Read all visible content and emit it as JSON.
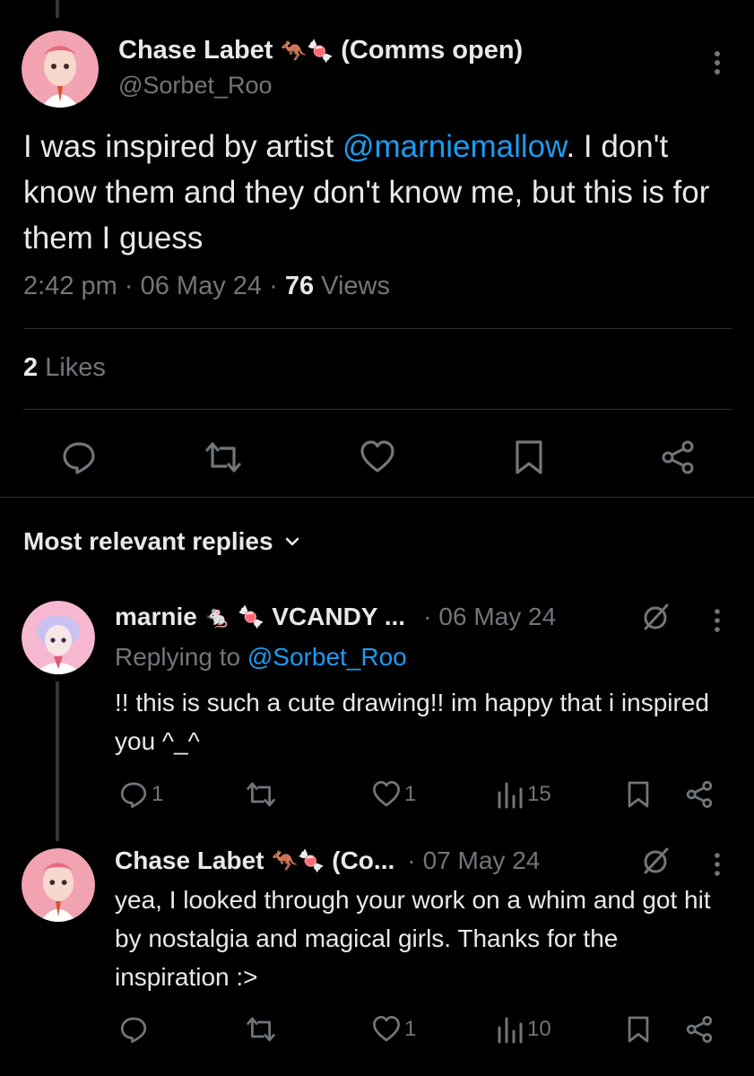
{
  "colors": {
    "bg": "#000000",
    "text": "#e7e9ea",
    "muted": "#71767b",
    "link": "#1d9bf0",
    "divider": "#2f3336"
  },
  "main_tweet": {
    "display_name": "Chase Labet",
    "name_emojis": "🦘🍬",
    "name_suffix": "(Comms open)",
    "handle": "@Sorbet_Roo",
    "text_before": "I was inspired by artist ",
    "mention": "@marniemallow",
    "text_after": ". I don't know them and they don't know me, but this is for them I guess",
    "time": "2:42 pm",
    "date": "06 May 24",
    "views_count": "76",
    "views_label": "Views",
    "likes_count": "2",
    "likes_label": "Likes",
    "sep": "·"
  },
  "replies_header": {
    "label": "Most relevant replies"
  },
  "replies": [
    {
      "display_name": "marnie",
      "name_emojis": "🐁 🍬",
      "name_suffix": "VCANDY ...",
      "date": "06 May 24",
      "replying_label": "Replying to ",
      "replying_to": "@Sorbet_Roo",
      "text": "!! this is such a cute drawing!! im happy that i inspired you ^_^",
      "replies_count": "1",
      "likes_count": "1",
      "views_count": "15"
    },
    {
      "display_name": "Chase Labet",
      "name_emojis": "🦘🍬",
      "name_suffix": "(Co...",
      "date": "07 May 24",
      "text": "yea, I looked through your work on a whim and got hit by nostalgia and magical girls. Thanks for the inspiration  :>",
      "likes_count": "1",
      "views_count": "10"
    }
  ],
  "icons": [
    "more-icon",
    "reply-icon",
    "retweet-icon",
    "like-icon",
    "bookmark-icon",
    "share-icon",
    "chevron-down-icon",
    "mute-icon",
    "views-icon"
  ]
}
